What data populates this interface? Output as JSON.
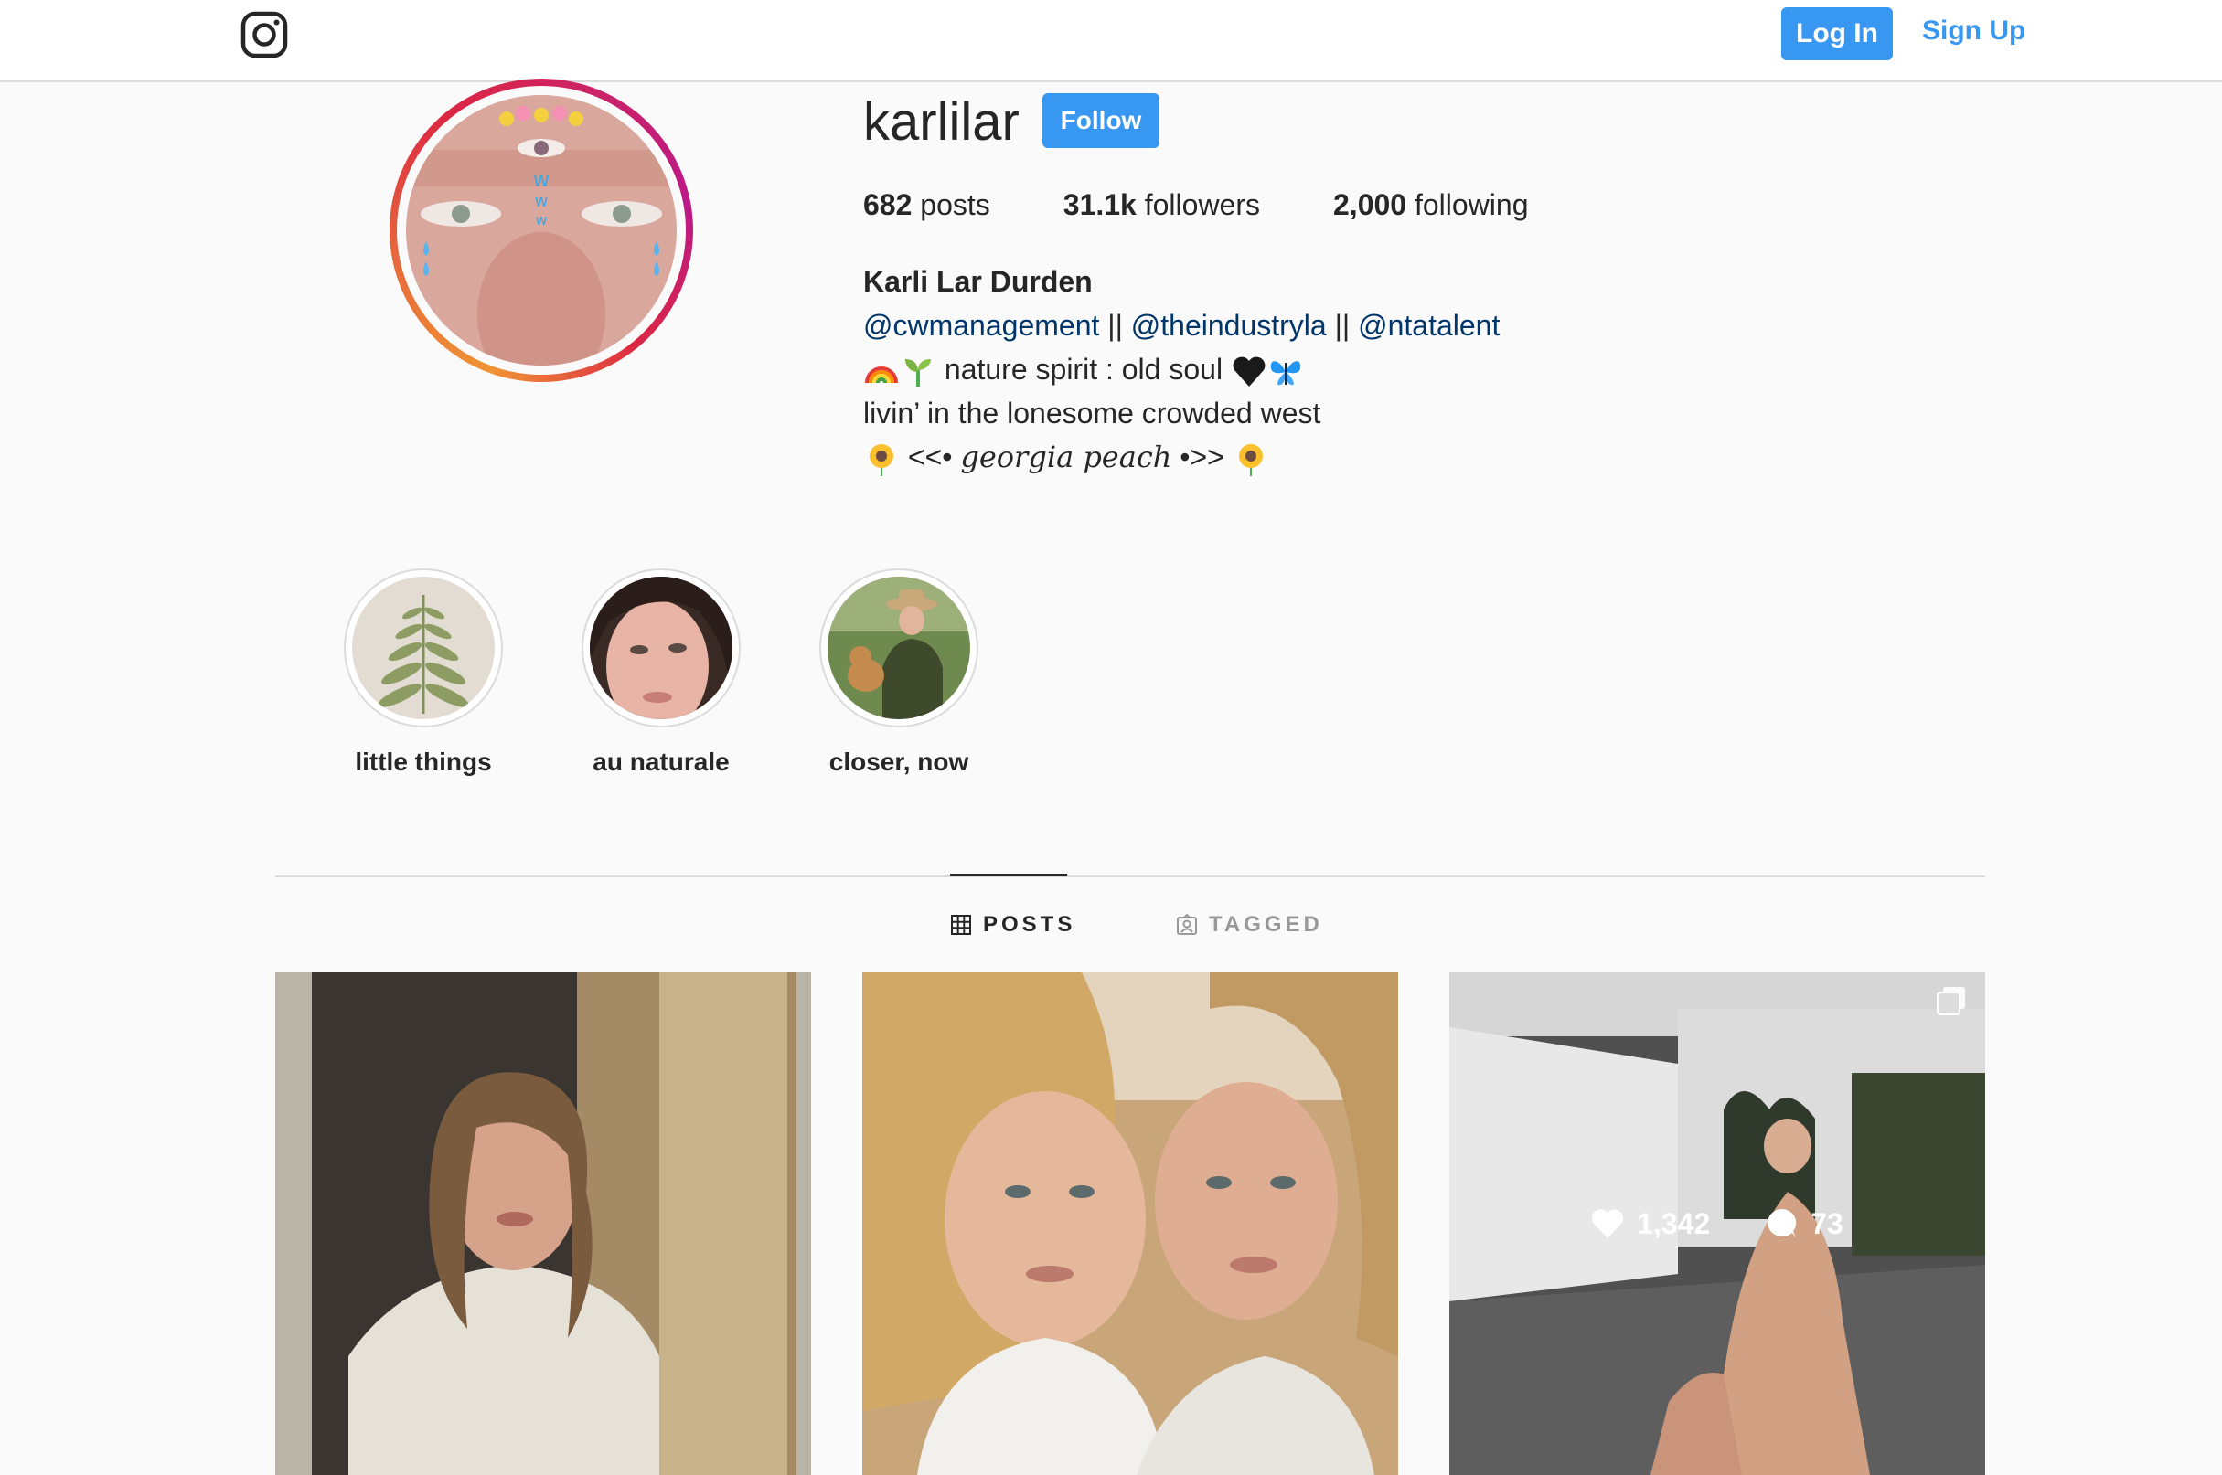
{
  "nav": {
    "login_label": "Log In",
    "signup_label": "Sign Up",
    "logo_icon": "instagram-icon"
  },
  "profile": {
    "username": "karlilar",
    "follow_label": "Follow",
    "stats": {
      "posts_value": "682",
      "posts_label": "posts",
      "followers_value": "31.1k",
      "followers_label": "followers",
      "following_value": "2,000",
      "following_label": "following"
    },
    "full_name": "Karli Lar Durden",
    "bio": {
      "mention_1": "@cwmanagement",
      "mention_2": "@theindustryla",
      "mention_3": "@ntatalent",
      "separator": "||",
      "line_2": "nature spirit : old soul",
      "line_3": "livin’ in the lonesome crowded west",
      "line_4_prefix": "<<•",
      "line_4_script": "georgia peach",
      "line_4_suffix": "•>>"
    }
  },
  "highlights": [
    {
      "label": "little things"
    },
    {
      "label": "au naturale"
    },
    {
      "label": "closer, now"
    }
  ],
  "tabs": {
    "posts_label": "POSTS",
    "tagged_label": "TAGGED"
  },
  "posts": [
    {
      "overlay_visible": false
    },
    {
      "overlay_visible": false
    },
    {
      "overlay_visible": true,
      "likes": "1,342",
      "comments": "73",
      "multi": true
    }
  ],
  "colors": {
    "accent": "#3897f0",
    "mention": "#003569",
    "text": "#262626",
    "muted": "#999999",
    "border": "#dbdbdb"
  }
}
